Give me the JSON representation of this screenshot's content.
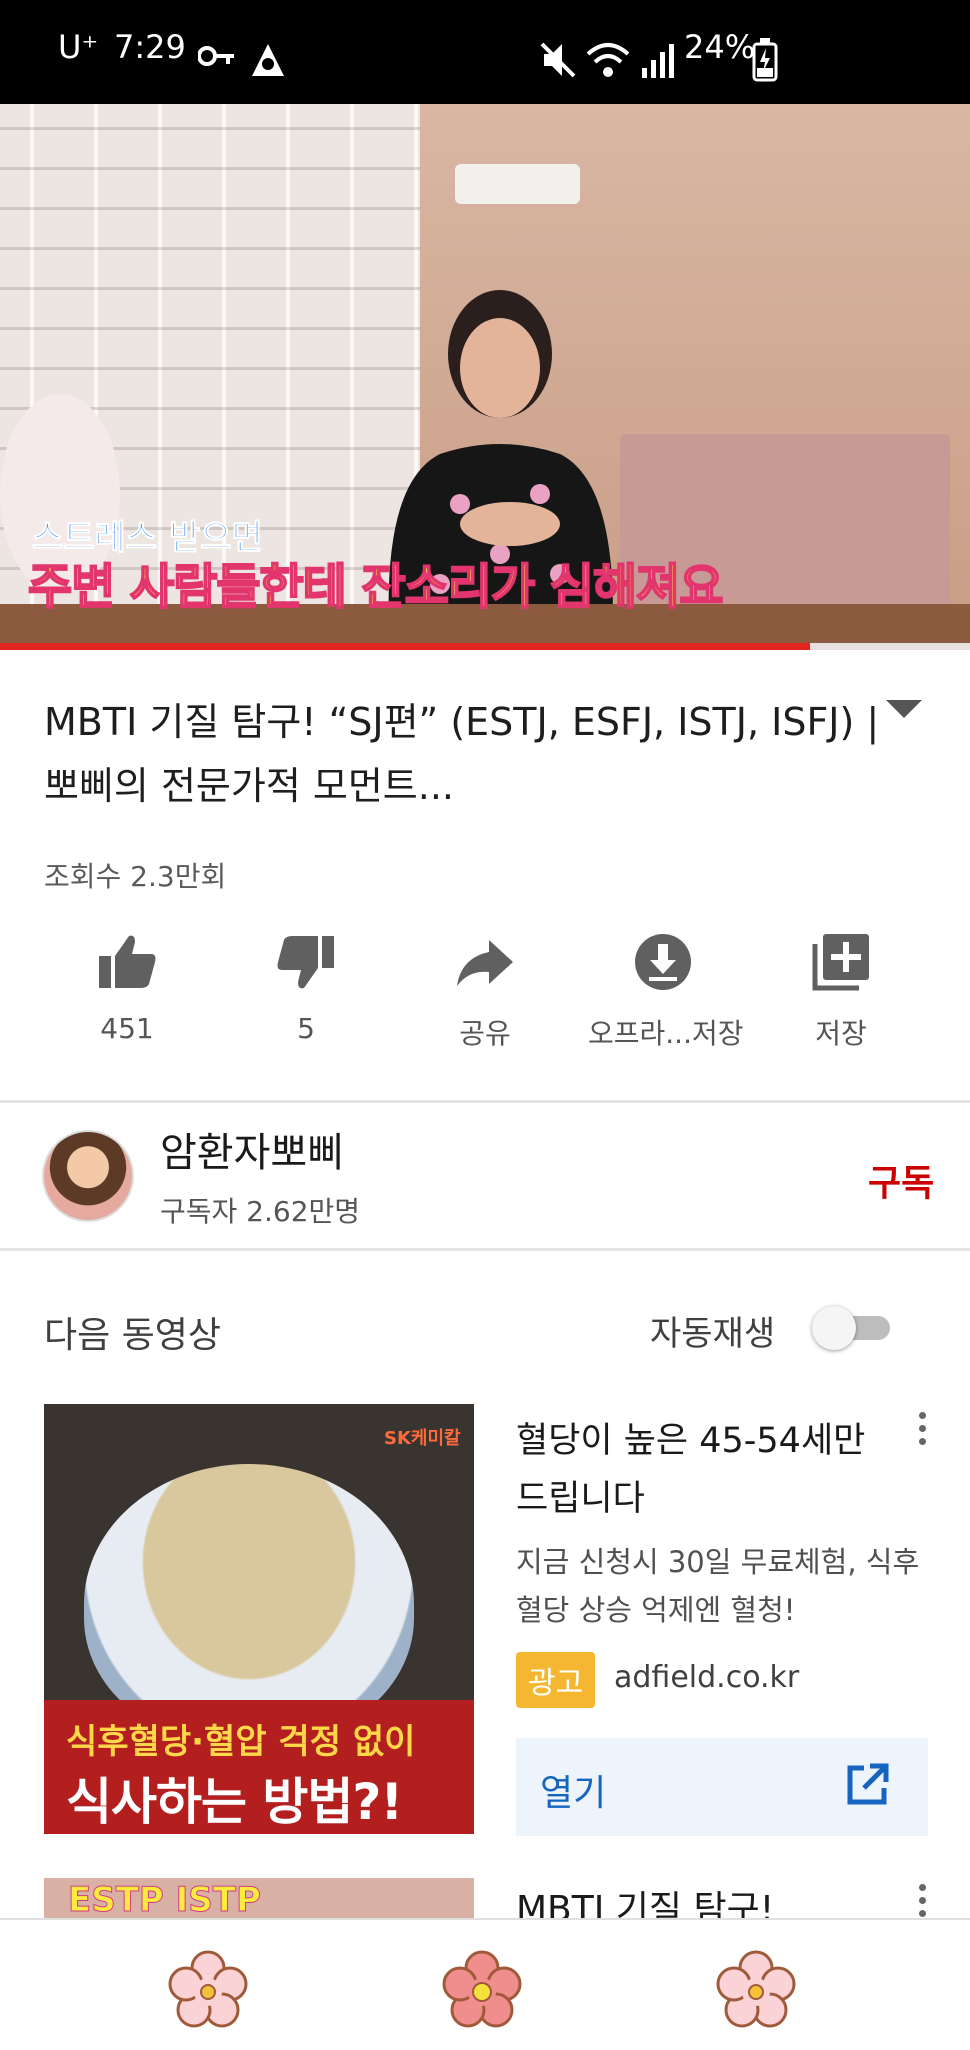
{
  "status_bar": {
    "carrier": "U⁺",
    "time": "7:29",
    "battery": "24%"
  },
  "video": {
    "subtitle_line1": "스트레스 받으면",
    "subtitle_line2": "주변 사람들한테 잔소리가 심해져요",
    "progress_fraction": 0.835
  },
  "video_info": {
    "title": "MBTI 기질 탐구! “SJ편” (ESTJ, ESFJ, ISTJ, ISFJ) | 뽀삐의 전문가적 모먼트...",
    "views": "조회수 2.3만회"
  },
  "actions": [
    {
      "icon": "thumbs-up-icon",
      "label": "451"
    },
    {
      "icon": "thumbs-down-icon",
      "label": "5"
    },
    {
      "icon": "share-icon",
      "label": "공유"
    },
    {
      "icon": "download-icon",
      "label": "오프라...저장"
    },
    {
      "icon": "add-to-playlist-icon",
      "label": "저장"
    }
  ],
  "channel": {
    "name": "암환자뽀삐",
    "subscribers": "구독자 2.62만명",
    "subscribe_label": "구독"
  },
  "up_next": {
    "heading": "다음 동영상",
    "autoplay_label": "자동재생",
    "autoplay_on": false
  },
  "ad": {
    "thumb_logo": "SK케미칼",
    "thumb_text1": "식후혈당·혈압 걱정 없이",
    "thumb_text2": "식사하는 방법?!",
    "title": "혈당이 높은 45-54세만 드립니다",
    "description": "지금 신청시 30일 무료체험, 식후 혈당 상승 억제엔 혈청!",
    "badge": "광고",
    "domain": "adfield.co.kr",
    "open_label": "열기"
  },
  "next_video": {
    "thumb_text": "ESTP ISTP",
    "title": "MBTI 기질 탐구!"
  },
  "bottom_nav": [
    {
      "icon": "flower-home-icon",
      "color": "#fbd3d6"
    },
    {
      "icon": "flower-active-icon",
      "color": "#f08d8d"
    },
    {
      "icon": "flower-library-icon",
      "color": "#fbd3d6"
    }
  ]
}
